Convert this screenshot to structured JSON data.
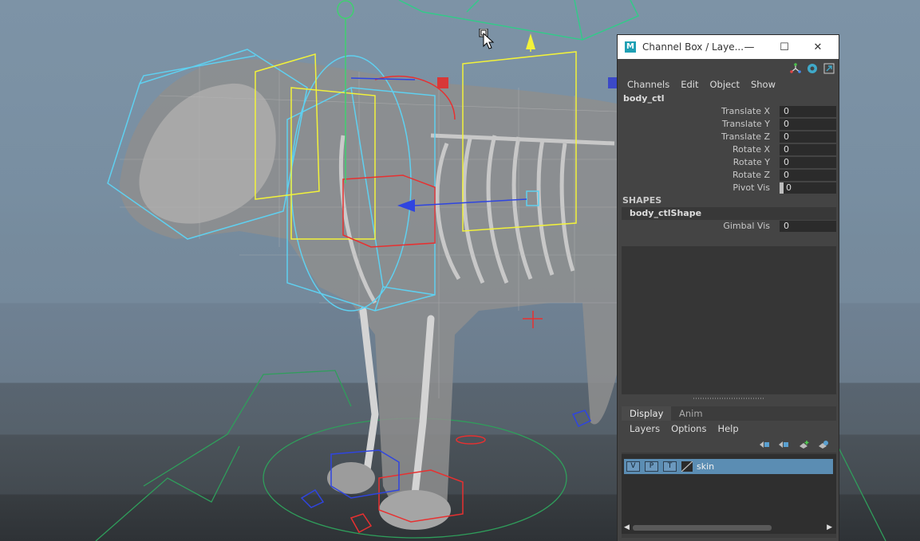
{
  "window": {
    "title": "Channel Box / Laye...",
    "minimize_symbol": "—",
    "maximize_symbol": "☐",
    "close_symbol": "✕"
  },
  "channel_box": {
    "menu": [
      "Channels",
      "Edit",
      "Object",
      "Show"
    ],
    "object_name": "body_ctl",
    "attributes": [
      {
        "label": "Translate X",
        "value": "0"
      },
      {
        "label": "Translate Y",
        "value": "0"
      },
      {
        "label": "Translate Z",
        "value": "0"
      },
      {
        "label": "Rotate X",
        "value": "0"
      },
      {
        "label": "Rotate Y",
        "value": "0"
      },
      {
        "label": "Rotate Z",
        "value": "0"
      },
      {
        "label": "Pivot Vis",
        "value": "0"
      }
    ],
    "shapes_header": "SHAPES",
    "shape_name": "body_ctlShape",
    "shape_attributes": [
      {
        "label": "Gimbal Vis",
        "value": "0"
      }
    ]
  },
  "layer_editor": {
    "tabs": [
      "Display",
      "Anim"
    ],
    "active_tab": "Display",
    "menu": [
      "Layers",
      "Options",
      "Help"
    ],
    "layers": [
      {
        "v": "V",
        "p": "P",
        "t": "T",
        "name": "skin"
      }
    ]
  },
  "icons": {
    "app_logo": "maya-logo-icon",
    "app_logo_letter": "M",
    "cursor": "mouse-pointer-icon"
  },
  "colors": {
    "layer_selected": "#5b8db3",
    "panel_bg": "#444444",
    "viewport_sky": "#7d93a6"
  }
}
